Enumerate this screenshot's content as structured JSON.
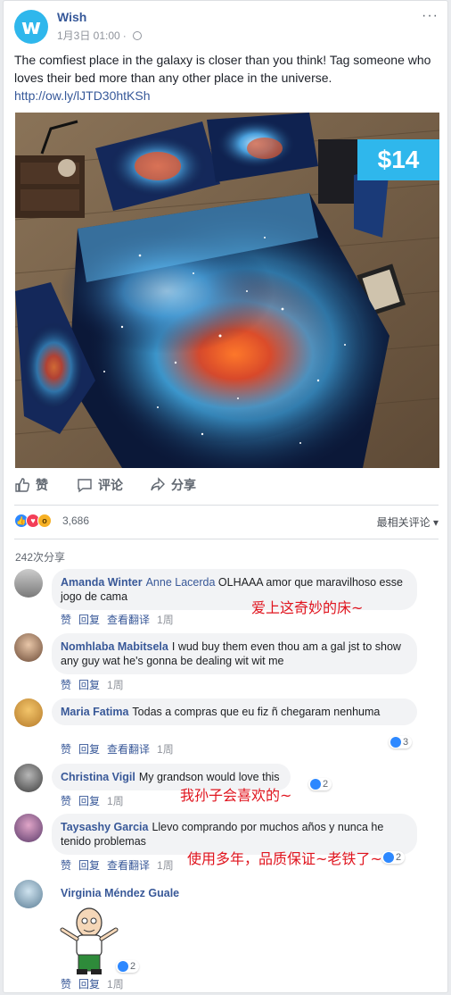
{
  "post": {
    "page_name": "Wish",
    "logo_letter": "w",
    "date": "1月3日 01:00",
    "more": "···",
    "text": "The comfiest place in the galaxy is closer than you think! Tag someone who loves their bed more than any other place in the universe.",
    "link": "http://ow.ly/lJTD30htKSh",
    "price": "$14"
  },
  "actions": {
    "like": "赞",
    "comment": "评论",
    "share": "分享"
  },
  "reactions": {
    "count": "3,686",
    "sort_label": "最相关评论 ▾",
    "shares": "242次分享"
  },
  "comments": [
    {
      "author": "Amanda Winter",
      "tag": "Anne Lacerda",
      "text": "OLHAAA amor que maravilhoso esse jogo de cama",
      "like": "赞",
      "reply": "回复",
      "translate": "查看翻译",
      "time": "1周",
      "annotation": "爱上这奇妙的床~"
    },
    {
      "author": "Nomhlaba Mabitsela",
      "text": "I wud buy them even thou am a gal jst to show any guy wat he's gonna be dealing wit wit me",
      "like": "赞",
      "reply": "回复",
      "time": "1周"
    },
    {
      "author": "Maria Fatima",
      "text": "Todas a compras que eu fiz ñ chegaram nenhuma",
      "like": "赞",
      "reply": "回复",
      "translate": "查看翻译",
      "time": "1周",
      "likes": "3"
    },
    {
      "author": "Christina Vigil",
      "text": "My grandson would love this",
      "like": "赞",
      "reply": "回复",
      "time": "1周",
      "likes": "2",
      "annotation": "我孙子会喜欢的~"
    },
    {
      "author": "Taysashy Garcia",
      "text": "Llevo comprando por muchos años y nunca he tenido problemas",
      "like": "赞",
      "reply": "回复",
      "translate": "查看翻译",
      "time": "1周",
      "likes": "2",
      "annotation": "使用多年，品质保证~老铁了~"
    },
    {
      "author": "Virginia Méndez Guale",
      "like": "赞",
      "reply": "回复",
      "time": "1周",
      "likes": "2"
    }
  ],
  "colors": {
    "brand": "#2fb7ec",
    "link": "#365899",
    "annotation": "#e0141e"
  }
}
